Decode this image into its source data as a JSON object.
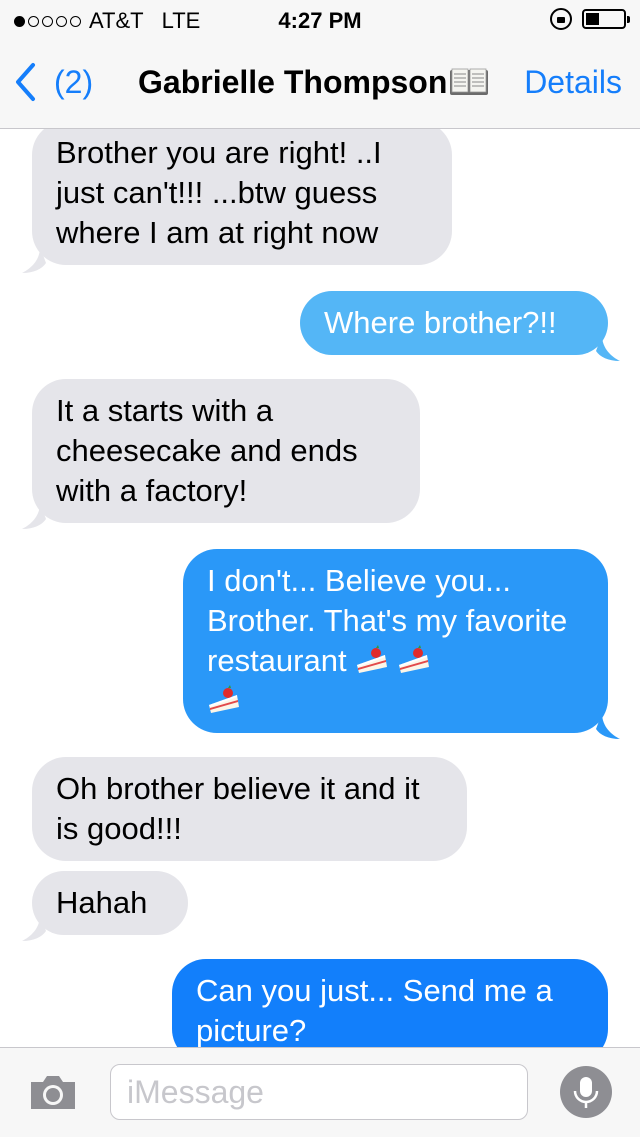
{
  "status_bar": {
    "signal_filled": 1,
    "signal_total": 5,
    "carrier": "AT&T",
    "network": "LTE",
    "time": "4:27 PM",
    "battery_level": 0.35
  },
  "nav": {
    "back_count": "(2)",
    "contact_name": "Gabrielle Thompson",
    "details_label": "Details"
  },
  "messages": [
    {
      "direction": "in",
      "text": "Brother you are right! ..I just can't!!! ...btw guess where I am at right now"
    },
    {
      "direction": "out",
      "text": "Where brother?!!"
    },
    {
      "direction": "in",
      "text": "It a starts with a cheesecake and ends with a factory!"
    },
    {
      "direction": "out",
      "text": "I don't... Believe you... Brother. That's my favorite restaurant",
      "emoji": [
        "shortcake",
        "shortcake",
        "shortcake"
      ]
    },
    {
      "direction": "in",
      "text": "Oh brother believe it and it is good!!!"
    },
    {
      "direction": "in",
      "text": "Hahah"
    },
    {
      "direction": "out",
      "text": "Can you just... Send me a picture?"
    }
  ],
  "composer": {
    "placeholder": "iMessage"
  },
  "colors": {
    "blue": "#157efb",
    "incoming_bubble": "#e5e5ea",
    "bar_background": "#f7f7f7"
  }
}
